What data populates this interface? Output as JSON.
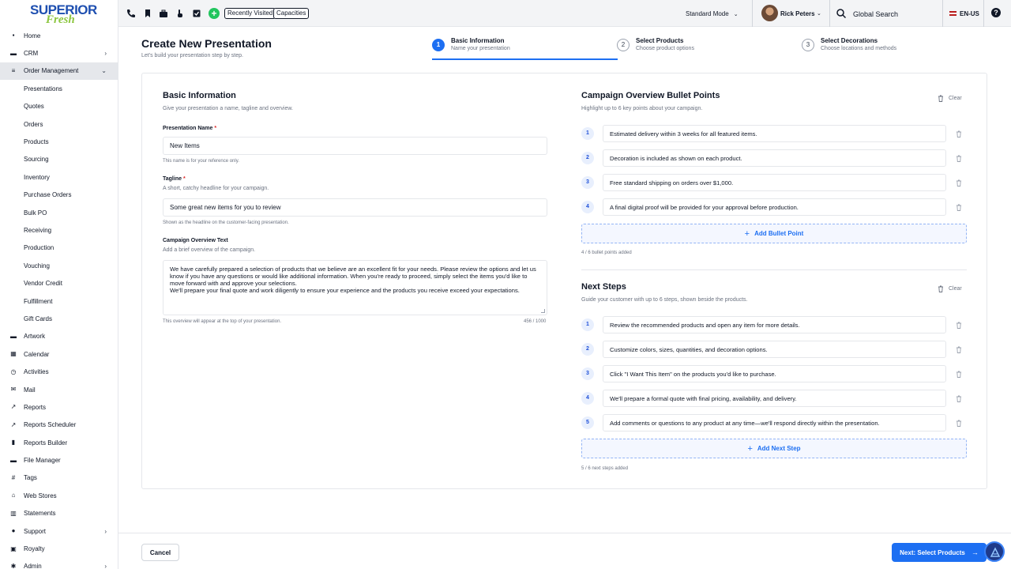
{
  "brand": {
    "line1": "SUPERIOR",
    "line2": "Fresh"
  },
  "sidebar": {
    "items": [
      {
        "label": "Home",
        "icon": "home-icon",
        "level": "top"
      },
      {
        "label": "CRM",
        "icon": "briefcase-icon",
        "level": "top",
        "chevron": "›"
      },
      {
        "label": "Order Management",
        "icon": "list-icon",
        "level": "top",
        "chevron": "⌄",
        "active": true
      },
      {
        "label": "Presentations",
        "level": "sub"
      },
      {
        "label": "Quotes",
        "level": "sub"
      },
      {
        "label": "Orders",
        "level": "sub"
      },
      {
        "label": "Products",
        "level": "sub"
      },
      {
        "label": "Sourcing",
        "level": "sub"
      },
      {
        "label": "Inventory",
        "level": "sub"
      },
      {
        "label": "Purchase Orders",
        "level": "sub"
      },
      {
        "label": "Bulk PO",
        "level": "sub"
      },
      {
        "label": "Receiving",
        "level": "sub"
      },
      {
        "label": "Production",
        "level": "sub"
      },
      {
        "label": "Vouching",
        "level": "sub"
      },
      {
        "label": "Vendor Credit",
        "level": "sub"
      },
      {
        "label": "Fulfillment",
        "level": "sub"
      },
      {
        "label": "Gift Cards",
        "level": "sub"
      },
      {
        "label": "Artwork",
        "icon": "artwork-icon",
        "level": "top"
      },
      {
        "label": "Calendar",
        "icon": "calendar-icon",
        "level": "top"
      },
      {
        "label": "Activities",
        "icon": "clock-icon",
        "level": "top"
      },
      {
        "label": "Mail",
        "icon": "mail-icon",
        "level": "top"
      },
      {
        "label": "Reports",
        "icon": "trend-icon",
        "level": "top"
      },
      {
        "label": "Reports Scheduler",
        "icon": "trend-icon",
        "level": "top"
      },
      {
        "label": "Reports Builder",
        "icon": "bar-chart-icon",
        "level": "top"
      },
      {
        "label": "File Manager",
        "icon": "folder-icon",
        "level": "top"
      },
      {
        "label": "Tags",
        "icon": "hash-icon",
        "level": "top"
      },
      {
        "label": "Web Stores",
        "icon": "store-icon",
        "level": "top"
      },
      {
        "label": "Statements",
        "icon": "bank-icon",
        "level": "top"
      },
      {
        "label": "Support",
        "icon": "help-circle-icon",
        "level": "top",
        "chevron": "›"
      },
      {
        "label": "Royalty",
        "icon": "calendar-check-icon",
        "level": "top"
      },
      {
        "label": "Admin",
        "icon": "gear-icon",
        "level": "top",
        "chevron": "›"
      }
    ]
  },
  "topbar": {
    "recently_visited": "Recently Visited",
    "capacities": "Capacities",
    "mode": "Standard Mode",
    "user_name": "Rick Peters",
    "search_label": "Global Search",
    "language": "EN-US",
    "help": "?"
  },
  "page": {
    "title": "Create New Presentation",
    "subtitle": "Let's build your presentation step by step."
  },
  "steps": [
    {
      "num": "1",
      "title": "Basic Information",
      "sub": "Name your presentation",
      "active": true
    },
    {
      "num": "2",
      "title": "Select Products",
      "sub": "Choose product options",
      "active": false
    },
    {
      "num": "3",
      "title": "Select Decorations",
      "sub": "Choose locations and methods",
      "active": false
    }
  ],
  "basic": {
    "title": "Basic Information",
    "subtitle": "Give your presentation a name, tagline and overview.",
    "name_label": "Presentation Name",
    "required_mark": "*",
    "name_value": "New Items",
    "name_help": "This name is for your reference only.",
    "tagline_label": "Tagline",
    "tagline_desc": "A short, catchy headline for your campaign.",
    "tagline_value": "Some great new items for you to review",
    "tagline_help": "Shown as the headline on the customer-facing presentation.",
    "overview_label": "Campaign Overview Text",
    "overview_desc": "Add a brief overview of the campaign.",
    "overview_p1": "We have carefully prepared a selection of products that we believe are an excellent fit for your needs. Please review the options and let us know if you have any questions or would like additional information. When you're ready to proceed, simply select the items you'd like to move forward with and approve your selections.",
    "overview_p2": "We'll prepare your final quote and work diligently to ensure your experience and the products you receive exceed your expectations.",
    "overview_help": "This overview will appear at the top of your presentation.",
    "overview_count": "456 / 1000"
  },
  "bullets": {
    "title": "Campaign Overview Bullet Points",
    "subtitle": "Highlight up to 6 key points about your campaign.",
    "clear": "Clear",
    "items": [
      "Estimated delivery within 3 weeks for all featured items.",
      "Decoration is included as shown on each product.",
      "Free standard shipping on orders over $1,000.",
      "A final digital proof will be provided for your approval before production."
    ],
    "add_label": "Add Bullet Point",
    "count": "4 / 6 bullet points added"
  },
  "next_steps": {
    "title": "Next Steps",
    "subtitle": "Guide your customer with up to 6 steps, shown beside the products.",
    "clear": "Clear",
    "items": [
      "Review the recommended products and open any item for more details.",
      "Customize colors, sizes, quantities, and decoration options.",
      "Click \"I Want This Item\" on the products you'd like to purchase.",
      "We'll prepare a formal quote with final pricing, availability, and delivery.",
      "Add comments or questions to any product at any time—we'll respond directly within the presentation."
    ],
    "add_label": "Add Next Step",
    "count": "5 / 6 next steps added"
  },
  "footer": {
    "cancel": "Cancel",
    "next": "Next: Select Products",
    "next_arrow": "→"
  },
  "colors": {
    "primary": "#1d6ff2",
    "success": "#22c55e",
    "required": "#dc2626",
    "brand_blue": "#1e4fb0",
    "brand_green": "#8cc63f"
  }
}
